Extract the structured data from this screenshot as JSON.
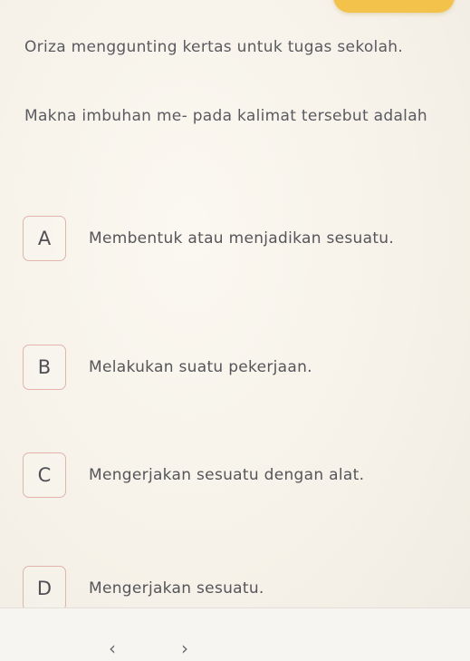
{
  "header": {
    "accent_color": "#f3c24a"
  },
  "question": {
    "sentence": "Oriza menggunting kertas untuk tugas sekolah.",
    "prompt": "Makna imbuhan me- pada kalimat tersebut adalah"
  },
  "options": [
    {
      "letter": "A",
      "text": "Membentuk atau menjadikan sesuatu."
    },
    {
      "letter": "B",
      "text": "Melakukan suatu pekerjaan."
    },
    {
      "letter": "C",
      "text": "Mengerjakan sesuatu dengan alat."
    },
    {
      "letter": "D",
      "text": "Mengerjakan sesuatu."
    }
  ],
  "option_border_color": "#e2b4ab",
  "bottom_nav": {
    "back_icon": "chevron-left-icon",
    "back_glyph": "‹",
    "forward_icon": "chevron-right-icon",
    "forward_glyph": "›"
  }
}
